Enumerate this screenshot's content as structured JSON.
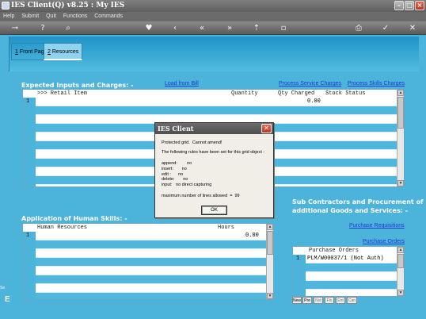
{
  "window": {
    "title": "IES Client(Q) v8.25 : My IES"
  },
  "menu": [
    "Help",
    "Submit",
    "Quit",
    "Functions",
    "Commands"
  ],
  "toolbar_icons": [
    "key-icon",
    "help-icon",
    "search-icon",
    "heart-icon",
    "back-icon",
    "rewind-icon",
    "forward-icon",
    "up-icon",
    "stop-icon",
    "print-icon",
    "check-icon",
    "close-icon"
  ],
  "tabs": [
    {
      "num": "1",
      "label": " Front Page"
    },
    {
      "num": "2",
      "label": " Resources"
    }
  ],
  "inputs": {
    "heading": "Expected Inputs and Charges: -",
    "load_link": "Load from Bill",
    "service_link": "Process Service Charges",
    "skills_link": "Process Skills Charges",
    "columns": [
      ">>> Retail Item",
      "Quantity",
      "Qty Charged",
      "Stock Status"
    ],
    "row_num": "1",
    "qty_charged": "0.00"
  },
  "human": {
    "heading": "Application of Human Skills: -",
    "columns": [
      "Human Resources",
      "Hours"
    ],
    "row_num": "1",
    "hours": "0.00"
  },
  "subcontractors": {
    "heading_line1": "Sub Contractors and Procurement of",
    "heading_line2": "additional Goods and Services: -",
    "req_link": "Purchase Requisitions",
    "orders_link": "Purchase Orders",
    "grid_header": "Purchase Orders",
    "row_num": "1",
    "row_value": "PLM/W00037/1 (Not Auth)",
    "nav": [
      "New",
      "Pre",
      "Nxt",
      "Fin",
      "Ent",
      "Can"
    ]
  },
  "dialog": {
    "title": "IES Client",
    "line1": "Protected grid.  Cannot amend!",
    "line2": "The following rules have been set for this grid object -",
    "rules": "append:        no\ninsert:       no\nedit :      no\ndelete:       no\ninput:   no direct capturing",
    "maxlines": "maximum number of lines allowed  =  99",
    "ok": "OK"
  },
  "misc": {
    "left_edge_label": "Se",
    "left_edge_letter": "E"
  }
}
